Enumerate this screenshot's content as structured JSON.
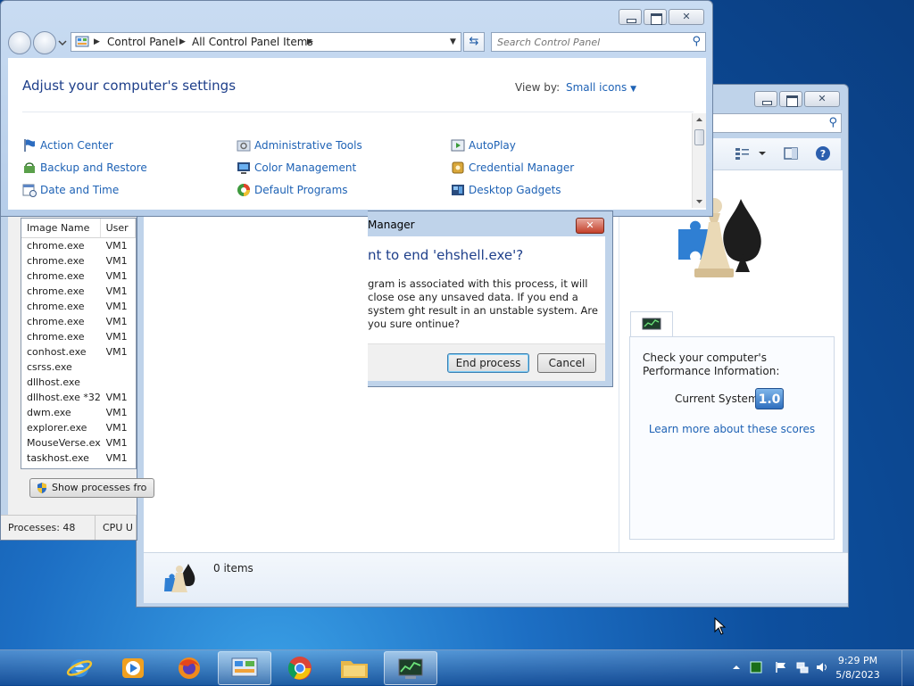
{
  "control_panel": {
    "breadcrumb": [
      "Control Panel",
      "All Control Panel Items"
    ],
    "search_placeholder": "Search Control Panel",
    "heading": "Adjust your computer's settings",
    "view_by_label": "View by:",
    "view_by_value": "Small icons",
    "items": [
      "Action Center",
      "Administrative Tools",
      "AutoPlay",
      "Backup and Restore",
      "Color Management",
      "Credential Manager",
      "Date and Time",
      "Default Programs",
      "Desktop Gadgets"
    ]
  },
  "task_manager": {
    "columns": [
      "Image Name",
      "User"
    ],
    "processes": [
      {
        "name": "chrome.exe",
        "user": "VM1"
      },
      {
        "name": "chrome.exe",
        "user": "VM1"
      },
      {
        "name": "chrome.exe",
        "user": "VM1"
      },
      {
        "name": "chrome.exe",
        "user": "VM1"
      },
      {
        "name": "chrome.exe",
        "user": "VM1"
      },
      {
        "name": "chrome.exe",
        "user": "VM1"
      },
      {
        "name": "chrome.exe",
        "user": "VM1"
      },
      {
        "name": "conhost.exe",
        "user": "VM1"
      },
      {
        "name": "csrss.exe",
        "user": ""
      },
      {
        "name": "dllhost.exe",
        "user": ""
      },
      {
        "name": "dllhost.exe *32",
        "user": "VM1"
      },
      {
        "name": "dwm.exe",
        "user": "VM1"
      },
      {
        "name": "explorer.exe",
        "user": "VM1"
      },
      {
        "name": "MouseVerse.exe",
        "user": "VM1"
      },
      {
        "name": "taskhost.exe",
        "user": "VM1"
      }
    ],
    "show_processes_label": "Show processes fro",
    "status_processes": "Processes: 48",
    "status_cpu": "CPU U"
  },
  "dialog": {
    "title": "Manager",
    "question": "nt to end 'ehshell.exe'?",
    "message": "gram is associated with this process, it will close ose any unsaved data. If you end a system ght result in an unstable system. Are you sure ontinue?",
    "end_label": "End process",
    "cancel_label": "Cancel"
  },
  "games": {
    "perf_text": "Check your computer's Performance Information:",
    "current_system_label": "Current System",
    "score": "1.0",
    "learn_more": "Learn more about these scores",
    "items_count": "0 items"
  },
  "taskbar": {
    "apps": [
      "internet-explorer",
      "windows-media-player",
      "firefox",
      "control-panel",
      "chrome",
      "windows-explorer",
      "task-manager"
    ],
    "time": "9:29 PM",
    "date": "5/8/2023"
  },
  "colors": {
    "link": "#1e62b5",
    "heading": "#1e3f8a",
    "close_red": "#c4402a",
    "score_blue": "#2f6fbe"
  }
}
